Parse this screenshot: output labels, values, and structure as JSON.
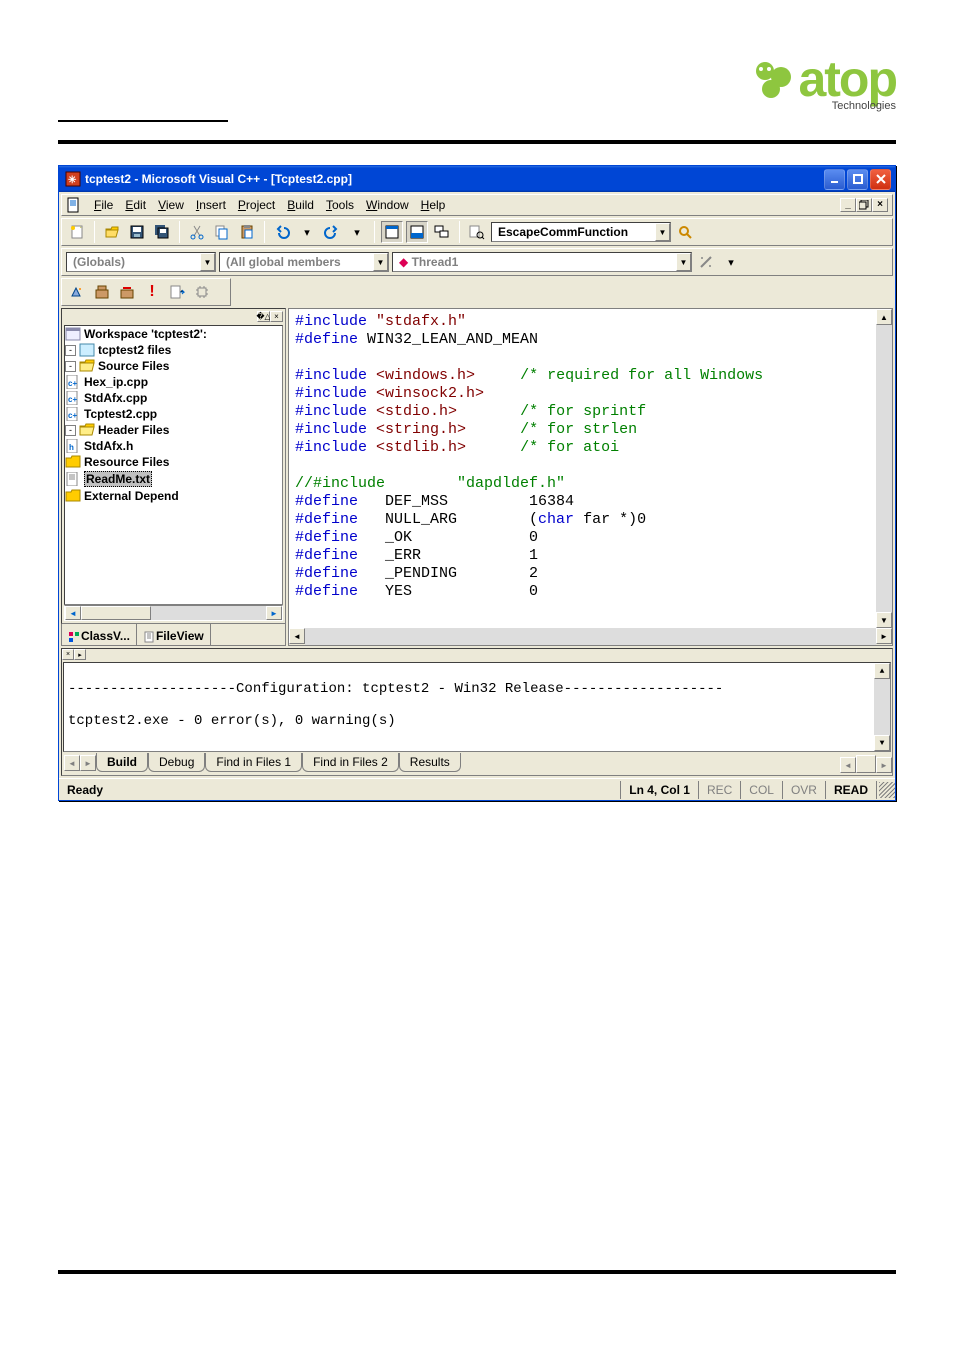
{
  "logo": {
    "brand": "atop",
    "subtitle": "Technologies"
  },
  "window": {
    "title": "tcptest2 - Microsoft Visual C++ - [Tcptest2.cpp]"
  },
  "menu": {
    "items": [
      "File",
      "Edit",
      "View",
      "Insert",
      "Project",
      "Build",
      "Tools",
      "Window",
      "Help"
    ]
  },
  "toolbar1": {
    "find_combo": "EscapeCommFunction"
  },
  "toolbar2": {
    "scope": "(Globals)",
    "members": "(All global members",
    "func": "Thread1"
  },
  "tree": {
    "workspace": "Workspace 'tcptest2':",
    "project": "tcptest2 files",
    "source_folder": "Source Files",
    "source_files": [
      "Hex_ip.cpp",
      "StdAfx.cpp",
      "Tcptest2.cpp"
    ],
    "header_folder": "Header Files",
    "header_files": [
      "StdAfx.h"
    ],
    "resource_folder": "Resource Files",
    "readme": "ReadMe.txt",
    "extdep": "External Depend",
    "tabs": {
      "class": "ClassV...",
      "file": "FileView"
    }
  },
  "editor": {
    "lines": [
      {
        "t": "kw",
        "v": "#include"
      },
      {
        "t": "sp",
        "v": " "
      },
      {
        "t": "str",
        "v": "\"stdafx.h\""
      },
      {
        "t": "nl"
      },
      {
        "t": "kw",
        "v": "#define"
      },
      {
        "t": "sp",
        "v": " "
      },
      {
        "t": "id",
        "v": "WIN32_LEAN_AND_MEAN"
      },
      {
        "t": "nl"
      },
      {
        "t": "nl"
      },
      {
        "t": "kw",
        "v": "#include"
      },
      {
        "t": "sp",
        "v": " "
      },
      {
        "t": "str",
        "v": "<windows.h>"
      },
      {
        "t": "sp",
        "v": "     "
      },
      {
        "t": "cm",
        "v": "/* required for all Windows"
      },
      {
        "t": "nl"
      },
      {
        "t": "kw",
        "v": "#include"
      },
      {
        "t": "sp",
        "v": " "
      },
      {
        "t": "str",
        "v": "<winsock2.h>"
      },
      {
        "t": "nl"
      },
      {
        "t": "kw",
        "v": "#include"
      },
      {
        "t": "sp",
        "v": " "
      },
      {
        "t": "str",
        "v": "<stdio.h>"
      },
      {
        "t": "sp",
        "v": "       "
      },
      {
        "t": "cm",
        "v": "/* for sprintf"
      },
      {
        "t": "nl"
      },
      {
        "t": "kw",
        "v": "#include"
      },
      {
        "t": "sp",
        "v": " "
      },
      {
        "t": "str",
        "v": "<string.h>"
      },
      {
        "t": "sp",
        "v": "      "
      },
      {
        "t": "cm",
        "v": "/* for strlen"
      },
      {
        "t": "nl"
      },
      {
        "t": "kw",
        "v": "#include"
      },
      {
        "t": "sp",
        "v": " "
      },
      {
        "t": "str",
        "v": "<stdlib.h>"
      },
      {
        "t": "sp",
        "v": "      "
      },
      {
        "t": "cm",
        "v": "/* for atoi"
      },
      {
        "t": "nl"
      },
      {
        "t": "nl"
      },
      {
        "t": "cm",
        "v": "//#include        \"dapdldef.h\""
      },
      {
        "t": "nl"
      },
      {
        "t": "kw",
        "v": "#define"
      },
      {
        "t": "sp",
        "v": "   "
      },
      {
        "t": "id",
        "v": "DEF_MSS"
      },
      {
        "t": "sp",
        "v": "         "
      },
      {
        "t": "id",
        "v": "16384"
      },
      {
        "t": "nl"
      },
      {
        "t": "kw",
        "v": "#define"
      },
      {
        "t": "sp",
        "v": "   "
      },
      {
        "t": "id",
        "v": "NULL_ARG"
      },
      {
        "t": "sp",
        "v": "        "
      },
      {
        "t": "id",
        "v": "("
      },
      {
        "t": "kw",
        "v": "char"
      },
      {
        "t": "id",
        "v": " far *)0"
      },
      {
        "t": "nl"
      },
      {
        "t": "kw",
        "v": "#define"
      },
      {
        "t": "sp",
        "v": "   "
      },
      {
        "t": "id",
        "v": "_OK"
      },
      {
        "t": "sp",
        "v": "             "
      },
      {
        "t": "id",
        "v": "0"
      },
      {
        "t": "nl"
      },
      {
        "t": "kw",
        "v": "#define"
      },
      {
        "t": "sp",
        "v": "   "
      },
      {
        "t": "id",
        "v": "_ERR"
      },
      {
        "t": "sp",
        "v": "            "
      },
      {
        "t": "id",
        "v": "1"
      },
      {
        "t": "nl"
      },
      {
        "t": "kw",
        "v": "#define"
      },
      {
        "t": "sp",
        "v": "   "
      },
      {
        "t": "id",
        "v": "_PENDING"
      },
      {
        "t": "sp",
        "v": "        "
      },
      {
        "t": "id",
        "v": "2"
      },
      {
        "t": "nl"
      },
      {
        "t": "kw",
        "v": "#define"
      },
      {
        "t": "sp",
        "v": "   "
      },
      {
        "t": "id",
        "v": "YES"
      },
      {
        "t": "sp",
        "v": "             "
      },
      {
        "t": "id",
        "v": "0"
      },
      {
        "t": "nl"
      }
    ]
  },
  "output": {
    "line1": "--------------------Configuration: tcptest2 - Win32 Release-------------------",
    "line2": "",
    "line3": "tcptest2.exe - 0 error(s), 0 warning(s)",
    "tabs": [
      "Build",
      "Debug",
      "Find in Files 1",
      "Find in Files 2",
      "Results"
    ]
  },
  "status": {
    "ready": "Ready",
    "pos": "Ln 4, Col 1",
    "ind": [
      "REC",
      "COL",
      "OVR",
      "READ"
    ]
  }
}
